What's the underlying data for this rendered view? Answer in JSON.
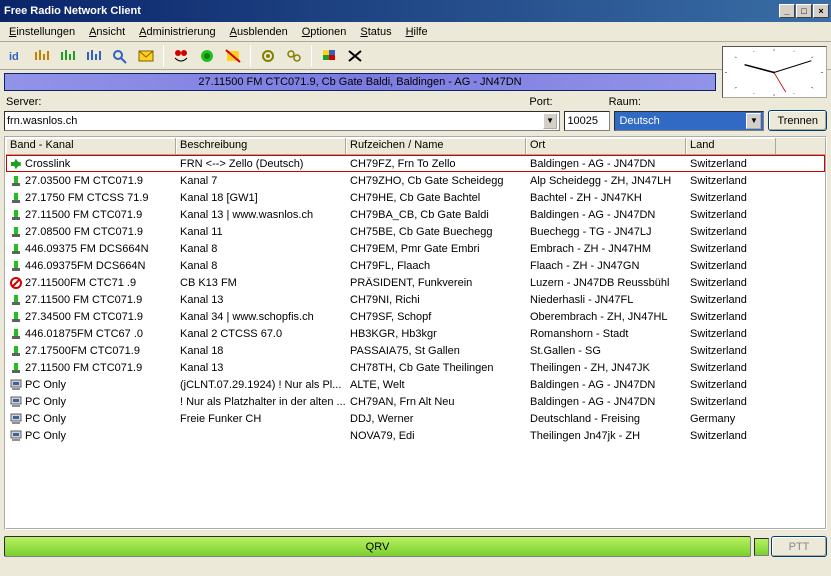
{
  "window": {
    "title": "Free Radio Network Client"
  },
  "menu": [
    "Einstellungen",
    "Ansicht",
    "Administrierung",
    "Ausblenden",
    "Optionen",
    "Status",
    "Hilfe"
  ],
  "banner": "27.11500 FM CTC071.9, Cb Gate Baldi, Baldingen - AG - JN47DN",
  "server": {
    "label": "Server:",
    "value": "frn.wasnlos.ch",
    "port_label": "Port:",
    "port": "10025",
    "room_label": "Raum:",
    "room": "Deutsch",
    "disconnect": "Trennen"
  },
  "columns": [
    "Band - Kanal",
    "Beschreibung",
    "Rufzeichen / Name",
    "Ort",
    "Land"
  ],
  "rows": [
    {
      "icon": "link",
      "hi": true,
      "c": [
        "Crosslink",
        "FRN <--> Zello (Deutsch)",
        "CH79FZ, Frn To Zello",
        "Baldingen - AG - JN47DN",
        "Switzerland"
      ]
    },
    {
      "icon": "gw",
      "c": [
        "27.03500 FM CTC071.9",
        "Kanal 7",
        "CH79ZHO, Cb Gate Scheidegg",
        "Alp Scheidegg - ZH, JN47LH",
        "Switzerland"
      ]
    },
    {
      "icon": "gw",
      "c": [
        "27.1750 FM CTCSS 71.9",
        "Kanal 18 [GW1]",
        "CH79HE, Cb Gate Bachtel",
        "Bachtel - ZH - JN47KH",
        "Switzerland"
      ]
    },
    {
      "icon": "gw",
      "c": [
        "27.11500 FM CTC071.9",
        "Kanal 13 | www.wasnlos.ch",
        "CH79BA_CB, Cb Gate Baldi",
        "Baldingen - AG - JN47DN",
        "Switzerland"
      ]
    },
    {
      "icon": "gw",
      "c": [
        "27.08500 FM CTC071.9",
        "Kanal 11",
        "CH75BE, Cb Gate Buechegg",
        "Buechegg - TG - JN47LJ",
        "Switzerland"
      ]
    },
    {
      "icon": "gw",
      "c": [
        "446.09375 FM DCS664N",
        "Kanal 8",
        "CH79EM, Pmr Gate Embri",
        "Embrach - ZH - JN47HM",
        "Switzerland"
      ]
    },
    {
      "icon": "gw",
      "c": [
        "446.09375FM DCS664N",
        "Kanal 8",
        "CH79FL, Flaach",
        "Flaach - ZH - JN47GN",
        "Switzerland"
      ]
    },
    {
      "icon": "blocked",
      "c": [
        "27.11500FM CTC71 .9",
        "CB K13 FM",
        "PRÄSIDENT, Funkverein",
        "Luzern - JN47DB Reussbühl",
        "Switzerland"
      ]
    },
    {
      "icon": "gw",
      "c": [
        "27.11500 FM CTC071.9",
        "Kanal 13",
        "CH79NI, Richi",
        "Niederhasli - JN47FL",
        "Switzerland"
      ]
    },
    {
      "icon": "gw",
      "c": [
        "27.34500 FM CTC071.9",
        "Kanal 34 | www.schopfis.ch",
        "CH79SF, Schopf",
        "Oberembrach - ZH, JN47HL",
        "Switzerland"
      ]
    },
    {
      "icon": "gw",
      "c": [
        "446.01875FM CTC67 .0",
        "Kanal 2 CTCSS 67.0",
        "HB3KGR, Hb3kgr",
        "Romanshorn - Stadt",
        "Switzerland"
      ]
    },
    {
      "icon": "gw",
      "c": [
        "27.17500FM CTC071.9",
        "Kanal 18",
        "PASSAIA75, St Gallen",
        "St.Gallen - SG",
        "Switzerland"
      ]
    },
    {
      "icon": "gw",
      "c": [
        "27.11500 FM CTC071.9",
        "Kanal 13",
        "CH78TH, Cb Gate Theilingen",
        "Theilingen - ZH, JN47JK",
        "Switzerland"
      ]
    },
    {
      "icon": "pc",
      "c": [
        "PC Only",
        "(jCLNT.07.29.1924) ! Nur als Pl...",
        "ALTE, Welt",
        "Baldingen - AG - JN47DN",
        "Switzerland"
      ]
    },
    {
      "icon": "pc",
      "c": [
        "PC Only",
        "! Nur als Platzhalter in der alten ...",
        "CH79AN, Frn Alt Neu",
        "Baldingen - AG - JN47DN",
        "Switzerland"
      ]
    },
    {
      "icon": "pc",
      "c": [
        "PC Only",
        "Freie Funker CH",
        "DDJ, Werner",
        "Deutschland - Freising",
        "Germany"
      ]
    },
    {
      "icon": "pc",
      "c": [
        "PC Only",
        "",
        "NOVA79, Edi",
        "Theilingen Jn47jk - ZH",
        "Switzerland"
      ]
    }
  ],
  "status": {
    "qrv": "QRV",
    "ptt": "PTT"
  }
}
